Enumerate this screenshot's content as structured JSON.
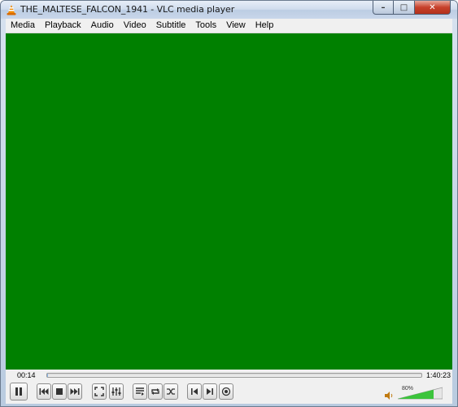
{
  "window": {
    "title": "THE_MALTESE_FALCON_1941 - VLC media player",
    "caption_buttons": {
      "minimize": "–",
      "maximize": "□",
      "close": "✕"
    }
  },
  "menu": {
    "items": [
      "Media",
      "Playback",
      "Audio",
      "Video",
      "Subtitle",
      "Tools",
      "View",
      "Help"
    ]
  },
  "video": {
    "background_color": "#008000"
  },
  "playback": {
    "elapsed": "00:14",
    "total": "1:40:23",
    "progress": 0.0023
  },
  "volume": {
    "label": "80%",
    "level": 0.8
  },
  "icons": {
    "app": "vlc-cone-icon",
    "buttons": [
      "pause-icon",
      "previous-icon",
      "stop-icon",
      "next-icon",
      "fullscreen-icon",
      "extended-settings-icon",
      "playlist-icon",
      "loop-icon",
      "random-icon",
      "frame-back-icon",
      "frame-next-icon",
      "record-icon",
      "speaker-icon"
    ]
  },
  "colors": {
    "seek_fill": "#8ab4e6",
    "volume_fill": "#3cc43c"
  }
}
